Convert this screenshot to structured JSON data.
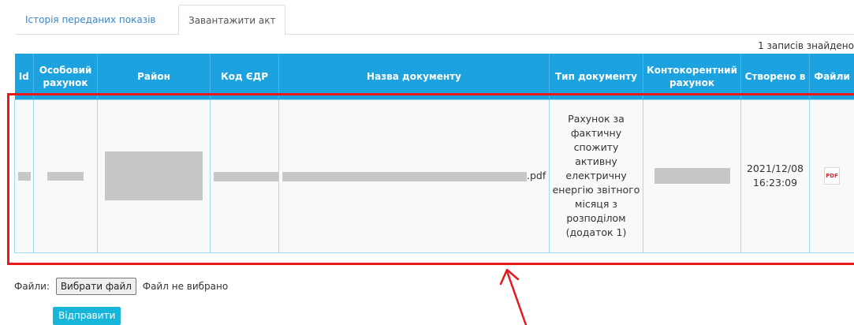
{
  "tabs": {
    "history": "Історія переданих показів",
    "upload": "Завантажити акт"
  },
  "records_count": "1 записів знайдено",
  "table": {
    "headers": {
      "id": "Id",
      "account": "Особовий рахунок",
      "district": "Район",
      "edrpou": "Код ЄДР",
      "doc_name": "Назва документу",
      "doc_type": "Тип документу",
      "contra_account": "Контокорентний рахунок",
      "created": "Створено в",
      "files": "Файли"
    },
    "row": {
      "doc_name_suffix": ".pdf",
      "doc_type": "Рахунок за фактичну спожиту активну електричну енергію звітного місяця з розподілом (додаток 1)",
      "created": "2021/12/08 16:23:09",
      "file_icon_label": "PDF"
    }
  },
  "form": {
    "files_label": "Файли:",
    "choose_button": "Вибрати файл",
    "no_file": "Файл не вибрано",
    "submit": "Відправити"
  },
  "colors": {
    "header_bg": "#1ca2df",
    "highlight": "#e8191c",
    "submit_bg": "#17b5d8",
    "link": "#3a87c7"
  },
  "icons": {
    "pdf": "pdf-file-icon",
    "annotation": "red-arrow"
  }
}
